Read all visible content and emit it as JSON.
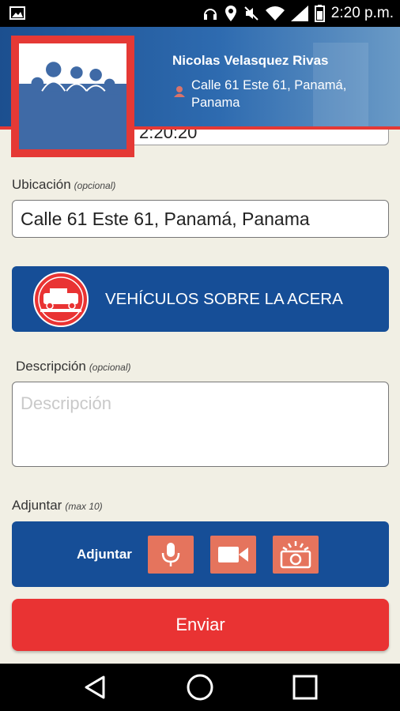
{
  "status_bar": {
    "time": "2:20 p.m.",
    "icons": [
      "image-icon",
      "headphones-icon",
      "location-icon",
      "mute-icon",
      "wifi-icon",
      "signal-icon",
      "battery-icon"
    ]
  },
  "user": {
    "name": "Nicolas Velasquez Rivas",
    "location": "Calle 61 Este 61, Panamá, Panama"
  },
  "form": {
    "hidden_field_value": "2:20:20",
    "location_label": "Ubicación",
    "location_optional": "(opcional)",
    "location_value": "Calle 61 Este 61, Panamá, Panama",
    "category_label": "VEHÍCULOS SOBRE LA ACERA",
    "description_label": "Descripción",
    "description_optional": "(opcional)",
    "description_placeholder": "Descripción",
    "attach_label": "Adjuntar",
    "attach_max": "(max 10)",
    "attach_button_label": "Adjuntar",
    "send_label": "Enviar"
  },
  "colors": {
    "primary_blue": "#164e97",
    "accent_red": "#e93333",
    "attach_orange": "#e5745d",
    "background": "#f1efe4"
  }
}
